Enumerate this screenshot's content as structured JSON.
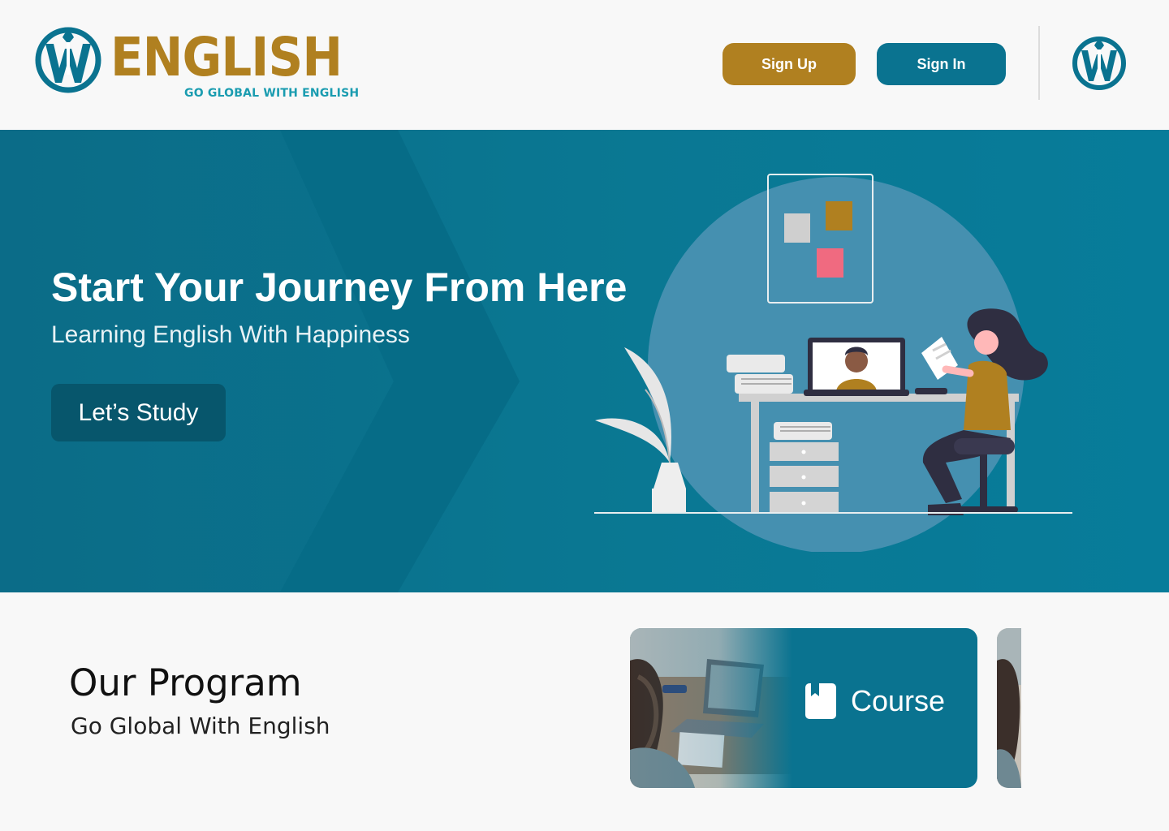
{
  "header": {
    "logo": {
      "wordmark": "ENGLISH",
      "tagline": "GO GLOBAL WITH ENGLISH",
      "icon": "w-logo-icon"
    },
    "signup_label": "Sign Up",
    "signin_label": "Sign In",
    "avatar_icon": "w-logo-icon"
  },
  "hero": {
    "title": "Start Your Journey From Here",
    "subtitle": "Learning English With Happiness",
    "cta_label": "Let’s Study"
  },
  "program": {
    "title": "Our Program",
    "subtitle": "Go Global With English",
    "cards": [
      {
        "label": "Course",
        "icon": "bookmark-book-icon"
      }
    ]
  },
  "colors": {
    "brand_gold": "#b08020",
    "brand_teal": "#0a7390",
    "tagline_teal": "#1a9cb0",
    "hero_bg": "#0a7893",
    "cta_dark": "#07566c",
    "page_bg": "#f8f8f8"
  }
}
